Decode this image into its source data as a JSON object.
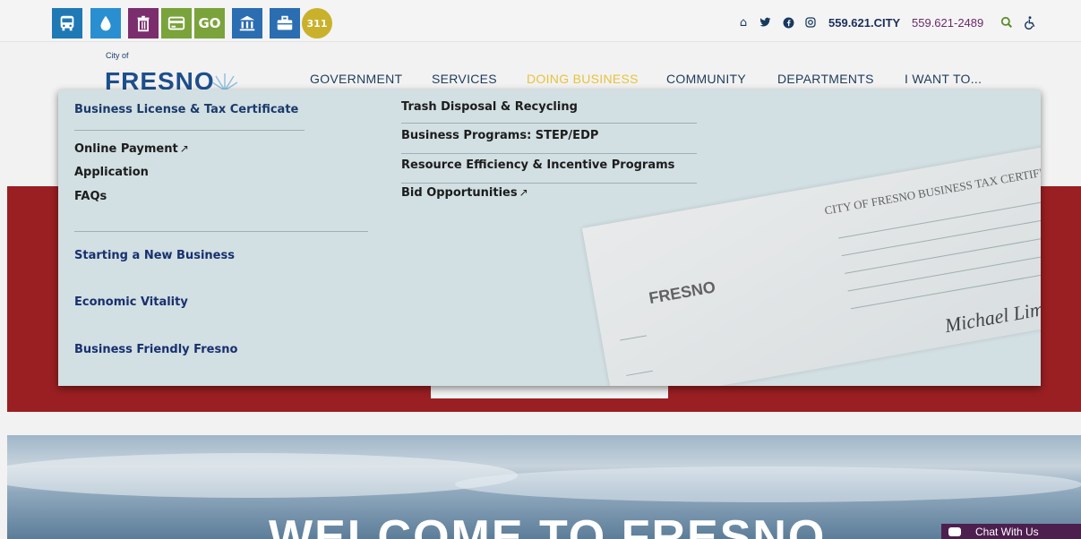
{
  "service_icons": [
    {
      "name": "bus-icon",
      "bg": "#1f79b4",
      "glyph": ""
    },
    {
      "name": "water-drop-icon",
      "bg": "#2a8fd0",
      "glyph": ""
    },
    {
      "name": "trash-icon",
      "bg": "#7b2d6d",
      "glyph": ""
    },
    {
      "name": "payment-card-icon",
      "bg": "#7aa33b",
      "glyph": ""
    },
    {
      "name": "go-icon",
      "bg": "#7aa33b",
      "glyph": "GO"
    },
    {
      "name": "city-hall-icon",
      "bg": "#2a6db1",
      "glyph": ""
    },
    {
      "name": "briefcase-icon",
      "bg": "#2a6db1",
      "glyph": ""
    },
    {
      "name": "311-icon",
      "bg": "#c9b12c",
      "glyph": "311"
    }
  ],
  "utility": {
    "home_icon": "home-icon",
    "twitter_icon": "twitter-icon",
    "facebook_icon": "facebook-icon",
    "instagram_icon": "instagram-icon",
    "city_line": "559.621.CITY",
    "phone": "559.621-2489",
    "search_icon": "search-icon",
    "accessibility_icon": "accessibility-icon"
  },
  "logo": {
    "small": "City of",
    "big": "FRESNO"
  },
  "nav": {
    "items": [
      "GOVERNMENT",
      "SERVICES",
      "DOING BUSINESS",
      "COMMUNITY",
      "DEPARTMENTS",
      "I WANT TO..."
    ],
    "active_index": 2
  },
  "menu": {
    "col1_header": "Business License & Tax Certificate",
    "col1_links": [
      "Online Payment",
      "Application",
      "FAQs"
    ],
    "col1_sections": [
      "Starting a New Business",
      "Economic Vitality",
      "Business Friendly Fresno"
    ],
    "col2_links": [
      "Trash Disposal & Recycling",
      "Business Programs: STEP/EDP",
      "Resource Efficiency & Incentive Programs",
      "Bid Opportunities"
    ],
    "certificate_title": "CITY OF FRESNO BUSINESS TAX CERTIFICATE",
    "certificate_logo": "FRESNO",
    "certificate_signature": "Michael Lima"
  },
  "hero": {
    "title": "WELCOME TO FRESNO"
  },
  "chat": {
    "label": "Chat With Us"
  },
  "colors": {
    "accent_gold": "#e8c23a",
    "nav_text": "#1f3b5c",
    "red_band": "#9a1f22",
    "menu_bg": "#d2dfe3",
    "chat_bg": "#4d1f4f"
  }
}
